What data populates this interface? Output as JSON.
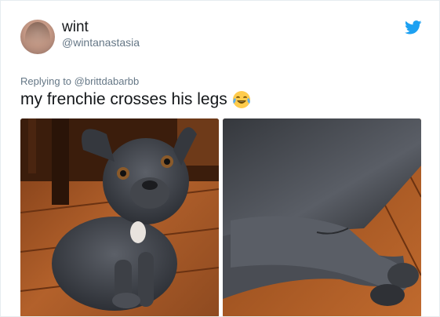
{
  "tweet": {
    "display_name": "wint",
    "handle": "@wintanastasia",
    "replying_to": "Replying to @brittdabarbb",
    "text": "my frenchie crosses his legs",
    "emoji": "face-with-tears-of-joy",
    "brand_color": "#1da1f2"
  },
  "media": {
    "photos": [
      {
        "subject": "dog-sitting-photo"
      },
      {
        "subject": "crossed-legs-closeup-photo"
      }
    ]
  }
}
